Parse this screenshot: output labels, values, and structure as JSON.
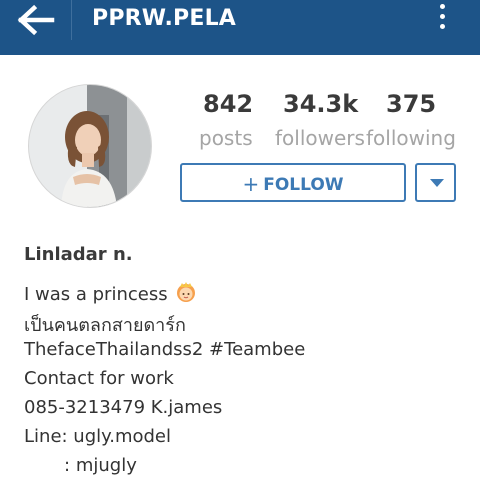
{
  "header": {
    "title": "PPRW.PELA",
    "back_icon": "arrow-left-icon",
    "menu_icon": "kebab-menu-icon",
    "background_color": "#1d5488"
  },
  "profile": {
    "stats": [
      {
        "value": "842",
        "label": "posts"
      },
      {
        "value": "34.3k",
        "label": "followers"
      },
      {
        "value": "375",
        "label": "following"
      }
    ],
    "follow_label": "FOLLOW",
    "accent_color": "#3d7ab5"
  },
  "bio": {
    "name": "Linladar n.",
    "lines": [
      "I was a princess",
      "เป็นคนตลกสายดาร์ก",
      "ThefaceThailandss2 #Teambee",
      "Contact for work",
      "085-3213479 K.james",
      "Line: ugly.model",
      "       : mjugly"
    ]
  }
}
